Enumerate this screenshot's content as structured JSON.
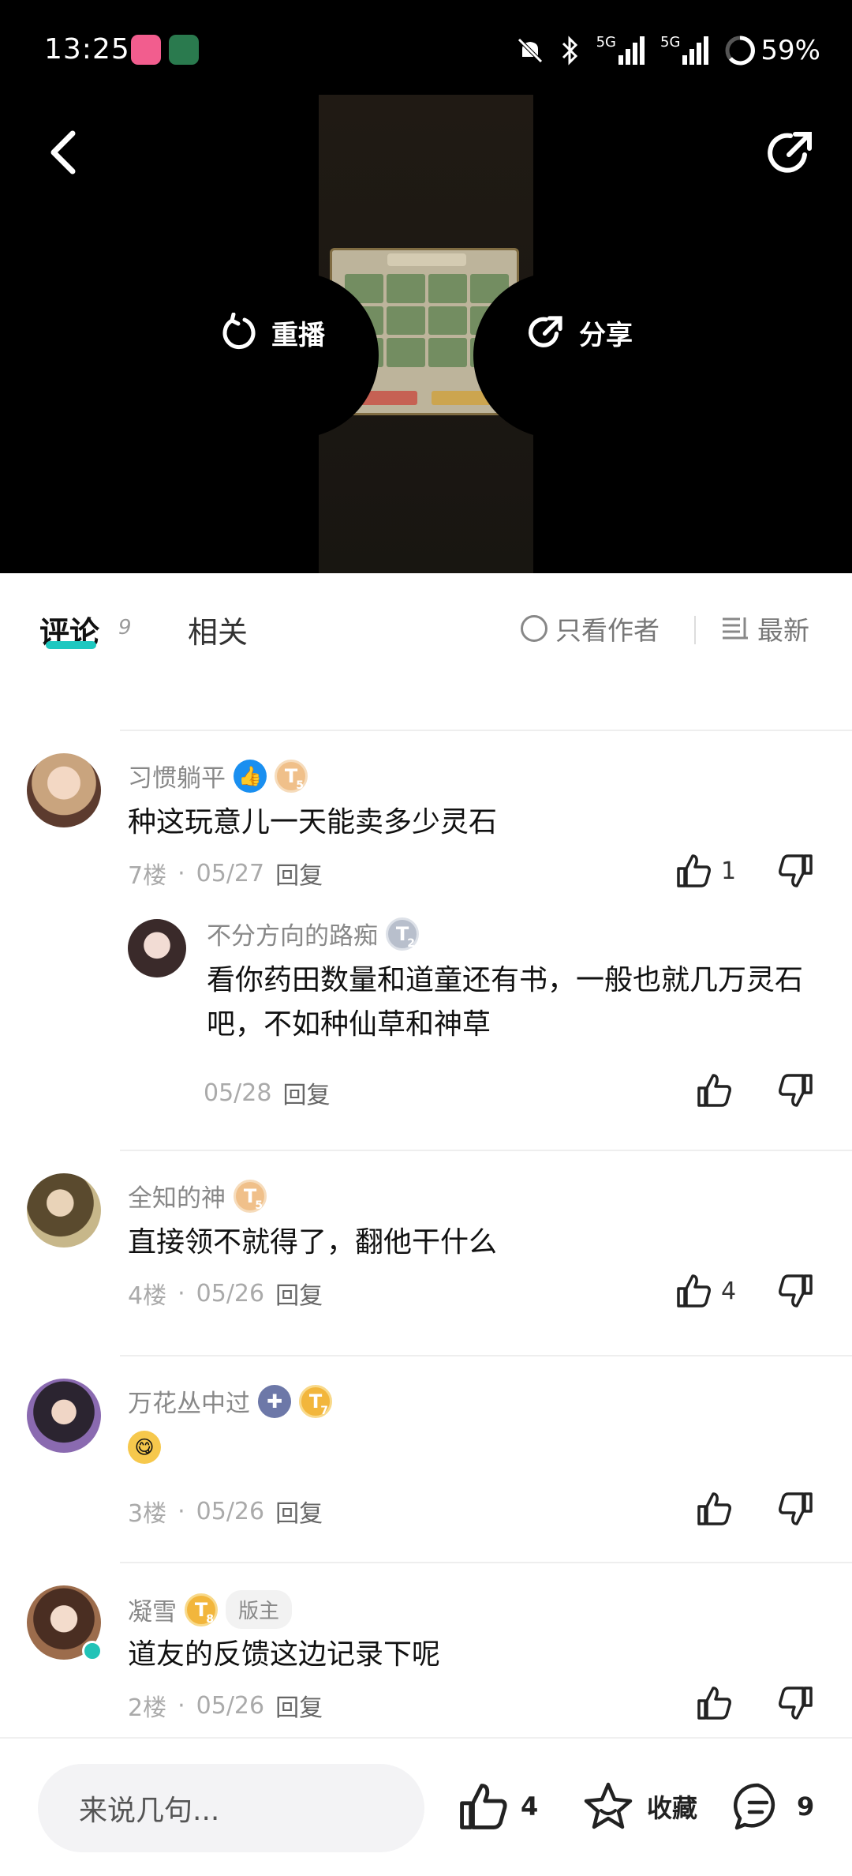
{
  "status_bar": {
    "time": "13:25",
    "battery": "59%",
    "network_1": "5G",
    "network_2": "5G",
    "icons": [
      "bilibili-app-icon",
      "game-app-icon",
      "mute-icon",
      "bluetooth-icon",
      "signal-icon",
      "battery-icon"
    ]
  },
  "video": {
    "replay_label": "重播",
    "share_label": "分享"
  },
  "tabs": {
    "comments_label": "评论",
    "comments_count": "9",
    "related_label": "相关",
    "author_only_label": "只看作者",
    "sort_label": "最新"
  },
  "comments": [
    {
      "username": "习惯躺平",
      "level": "5",
      "content": "种这玩意儿一天能卖多少灵石",
      "floor": "7楼",
      "date": "05/27",
      "reply_label": "回复",
      "likes": "1"
    },
    {
      "username": "不分方向的路痴",
      "level": "2",
      "content": "看你药田数量和道童还有书，一般也就几万灵石吧，不如种仙草和神草",
      "date": "05/28",
      "reply_label": "回复"
    },
    {
      "username": "全知的神",
      "level": "5",
      "content": "直接领不就得了，翻他干什么",
      "floor": "4楼",
      "date": "05/26",
      "reply_label": "回复",
      "likes": "4"
    },
    {
      "username": "万花丛中过",
      "level": "7",
      "floor": "3楼",
      "date": "05/26",
      "reply_label": "回复"
    },
    {
      "username": "凝雪",
      "level": "8",
      "moderator_label": "版主",
      "content": "道友的反馈这边记录下呢",
      "floor": "2楼",
      "date": "05/26",
      "reply_label": "回复"
    }
  ],
  "bottom_bar": {
    "input_placeholder": "来说几句...",
    "like_count": "4",
    "favorite_label": "收藏",
    "comment_count": "9"
  },
  "colors": {
    "accent": "#1ec8c0",
    "blue_badge": "#1a8ff0",
    "gold_badge": "#f2b63c"
  }
}
